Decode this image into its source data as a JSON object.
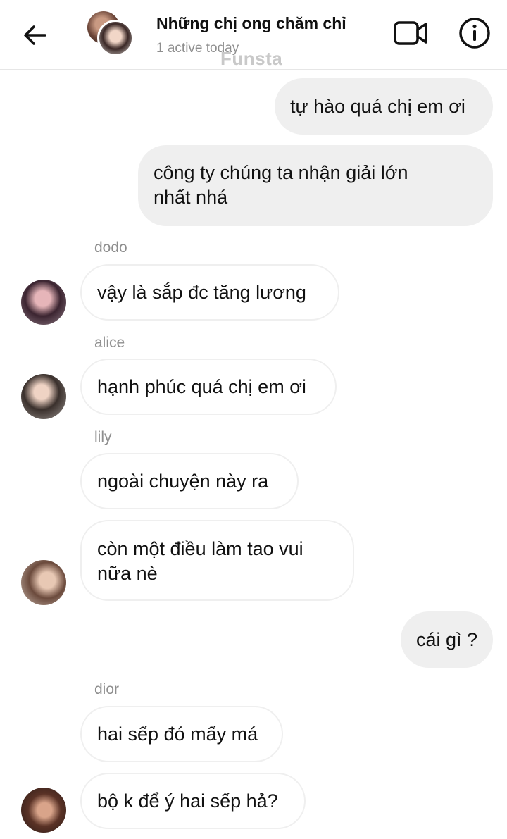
{
  "header": {
    "title": "Những chị ong chăm chỉ",
    "subtitle": "1 active today",
    "watermark": "Funsta"
  },
  "messages": {
    "m1": {
      "text": "tự hào quá chị em ơi"
    },
    "m2": {
      "line1": "công ty chúng ta nhận giải lớn",
      "line2": "nhất nhá"
    },
    "m3": {
      "sender": "dodo",
      "text": "vậy là sắp đc tăng lương"
    },
    "m4": {
      "sender": "alice",
      "text": "hạnh phúc quá chị em ơi"
    },
    "m5": {
      "sender": "lily",
      "text": "ngoài chuyện này ra"
    },
    "m6": {
      "line1": "còn một điều làm tao vui",
      "line2": "nữa nè"
    },
    "m7": {
      "text": "cái gì ?"
    },
    "m8": {
      "sender": "dior",
      "text": "hai sếp đó mấy má"
    },
    "m9": {
      "text": "bộ k để ý hai sếp hả?"
    }
  },
  "icons": {
    "back": "arrow-left-icon",
    "video": "video-camera-icon",
    "info": "info-icon"
  },
  "colors": {
    "outgoing_bubble": "#efefef",
    "incoming_border": "#efefef",
    "secondary_text": "#8e8e8e",
    "primary_text": "#111111"
  }
}
